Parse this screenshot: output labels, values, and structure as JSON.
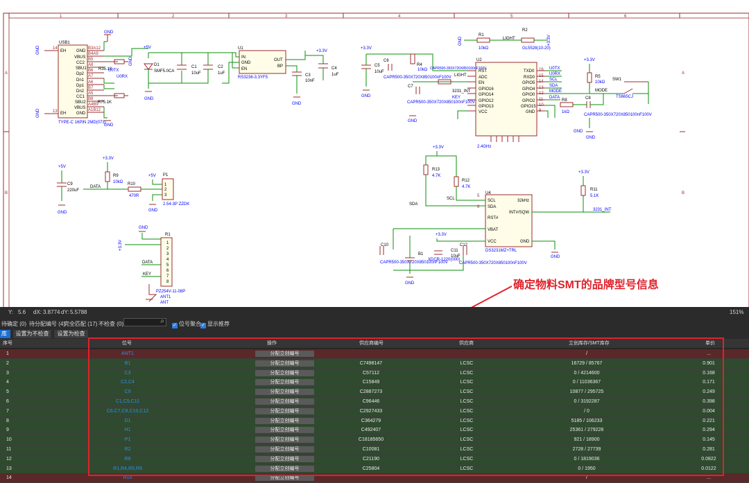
{
  "callout": {
    "text": "确定物料SMT的品牌型号信息"
  },
  "frame": {
    "cols": [
      "1",
      "2",
      "3",
      "4",
      "5",
      "6"
    ],
    "rows": [
      "A",
      "B"
    ]
  },
  "labels": {
    "usb1": "USB1",
    "usb_pn": "TYPE-C 16PIN 2MD(073)",
    "usb_pins": [
      "EH",
      "GND",
      "VBUS",
      "CC2",
      "SBU1",
      "Dp2",
      "Dn1",
      "Dp1",
      "Dn2",
      "CC1",
      "SBU2",
      "VBUS",
      "GND",
      "EH"
    ],
    "usb_nums": [
      "B3A12",
      "B4A9",
      "B5",
      "A8",
      "B6",
      "A7",
      "A6",
      "B7",
      "A5",
      "B8",
      "A4B9",
      "A1B12"
    ],
    "usb_edge": [
      "14",
      "13"
    ],
    "gnd": "GND",
    "p5v": "+5V",
    "p33v": "+3.3V",
    "r35": "R35.1K",
    "r75": "R75.1K",
    "u0tx": "U0TX",
    "u0rx": "U0RX",
    "d1": "D1",
    "d1_pn": "SMF5.0CA",
    "c1": "C1",
    "c1v": "10uF",
    "c2": "C2",
    "c2v": "1uF",
    "u1": "U1",
    "u1_pn": "RS3236-3.3YF5",
    "u1_in": "IN",
    "u1_gnd": "GND",
    "u1_en": "EN",
    "u1_out": "OUT",
    "u1_bp": "BP",
    "c3": "C3",
    "c3v": "10nF",
    "c4": "C4",
    "c4v": "1uF",
    "c5": "C5",
    "c5v": "10uF",
    "c6": "C6",
    "r4": "R4",
    "r4v": "10kΩ",
    "c7": "C7",
    "capr1": "CAPR500-350X720X850100nF100V",
    "capr2": "CAPR500-350X720X850100nF100V",
    "u2": "U2",
    "u2_pn": "2.4GHz",
    "u2_left": [
      "RST",
      "ADC",
      "EN",
      "GPIO16",
      "GPIO14",
      "GPIO12",
      "GPIO13",
      "VCC"
    ],
    "u2_right": [
      "TXD0",
      "RXD0",
      "GPIO5",
      "GPIO4",
      "GPIO0",
      "GPIO2",
      "GPIO15",
      "GND"
    ],
    "u2_rnum": [
      "16",
      "15",
      "14",
      "13",
      "12",
      "11",
      "10",
      "9"
    ],
    "light": "LIGHT",
    "int": "3231_INT",
    "key": "KEY",
    "r1": "R1",
    "r1v": "10kΩ",
    "r2": "R2",
    "r2v": "GL5528(10-20)",
    "net_right": [
      "U0TX",
      "U0RX",
      "SCL",
      "SDA",
      "MODE",
      "DATA"
    ],
    "r5": "R5",
    "r5v": "10kΩ",
    "sw1": "SW1",
    "sw_pn": "TS665CJ",
    "mode": "MODE",
    "r8": "R8",
    "r8v": "1kΩ",
    "c8": "C8",
    "capr3": "CAPR500-350X720X850100nF100V",
    "c9": "C9",
    "c9v": "220uF",
    "r9": "R9",
    "r9v": "10kΩ",
    "data": "DATA",
    "r10": "R10",
    "r10v": "470R",
    "p1": "P1",
    "p1_pn": "2.54-3P ZZDK",
    "r13": "R13",
    "r13v": "4.7K",
    "r12": "R12",
    "r12v": "4.7K",
    "u4": "U4",
    "u4_pn": "DS3231MZ+TRL",
    "u4_l": [
      "SCL",
      "SDA",
      "RST#",
      "VBAT",
      "VCC"
    ],
    "u4_r": [
      "32kHz",
      "INT#/SQW",
      "GND"
    ],
    "sda": "SDA",
    "scl": "SCL",
    "r11": "R11",
    "r11v": "5.1K",
    "int2": "3231_INT",
    "r1c": "R1",
    "r1c_pn": "PZ254V-11-08P",
    "ant": "ANT1",
    "ant2": "ANT",
    "c10": "C10",
    "b1": "B1",
    "b1_pn": "XDCR-1220(000)",
    "c11": "C11",
    "c11v": "10uF",
    "c12": "C12",
    "capr4": "CAPR500-350X720X850100nF100V",
    "capr5": "CAPR500-350X720X850100nF100V"
  },
  "status": {
    "y_label": "Y:",
    "y": "5.6",
    "dx_label": "dX:",
    "dx": "3.8774",
    "dy_label": "dY:",
    "dy": "5.5788",
    "zoom": "151%"
  },
  "filter": {
    "unconfirmed": "待确定 (0)",
    "pending": "待分配编号 (4)",
    "matched": "完全匹配 (17)",
    "unchecked": "不检查 (0)",
    "merge": "位号聚合",
    "show_recommend": "显示推荐"
  },
  "actions": {
    "tab": "库",
    "set_uncheck": "设置为不检查",
    "set_check": "设置为检查"
  },
  "table": {
    "headers": [
      "序号",
      "位号",
      "操作",
      "供应商编号",
      "供应商",
      "立创库存/SMT库存",
      "单价"
    ],
    "assign_label": "分配立创编号",
    "rows": [
      {
        "idx": "1",
        "des": "ANT1",
        "part": "",
        "sup": "",
        "stock": "/",
        "price": "..."
      },
      {
        "idx": "2",
        "des": "B1",
        "part": "C7498147",
        "sup": "LCSC",
        "stock": "16729 / 85767",
        "price": "0.901"
      },
      {
        "idx": "3",
        "des": "C3",
        "part": "C57112",
        "sup": "LCSC",
        "stock": "0 / 4214600",
        "price": "0.168"
      },
      {
        "idx": "4",
        "des": "C2,C4",
        "part": "C15849",
        "sup": "LCSC",
        "stock": "0 / 11036367",
        "price": "0.171"
      },
      {
        "idx": "5",
        "des": "C9",
        "part": "C2887273",
        "sup": "LCSC",
        "stock": "10877 / 295725",
        "price": "0.249"
      },
      {
        "idx": "6",
        "des": "C1,C5,C11",
        "part": "C96446",
        "sup": "LCSC",
        "stock": "0 / 3192287",
        "price": "0.398"
      },
      {
        "idx": "7",
        "des": "C6,C7,C8,C10,C12",
        "part": "C2927433",
        "sup": "LCSC",
        "stock": "/ 0",
        "price": "0.004"
      },
      {
        "idx": "8",
        "des": "D1",
        "part": "C364279",
        "sup": "LCSC",
        "stock": "5185 / 106233",
        "price": "0.221"
      },
      {
        "idx": "9",
        "des": "H1",
        "part": "C492407",
        "sup": "LCSC",
        "stock": "25361 / 279228",
        "price": "0.294"
      },
      {
        "idx": "10",
        "des": "P1",
        "part": "C18185650",
        "sup": "LCSC",
        "stock": "921 / 18900",
        "price": "0.145"
      },
      {
        "idx": "11",
        "des": "R2",
        "part": "C10081",
        "sup": "LCSC",
        "stock": "2728 / 27739",
        "price": "0.281"
      },
      {
        "idx": "12",
        "des": "R8",
        "part": "C21190",
        "sup": "LCSC",
        "stock": "0 / 1819036",
        "price": "0.0822"
      },
      {
        "idx": "13",
        "des": "R1,R4,R5,R9",
        "part": "C25804",
        "sup": "LCSC",
        "stock": "0 / 1950",
        "price": "0.0122"
      },
      {
        "idx": "14",
        "des": "R10",
        "part": "",
        "sup": "",
        "stock": "/",
        "price": "..."
      }
    ]
  }
}
